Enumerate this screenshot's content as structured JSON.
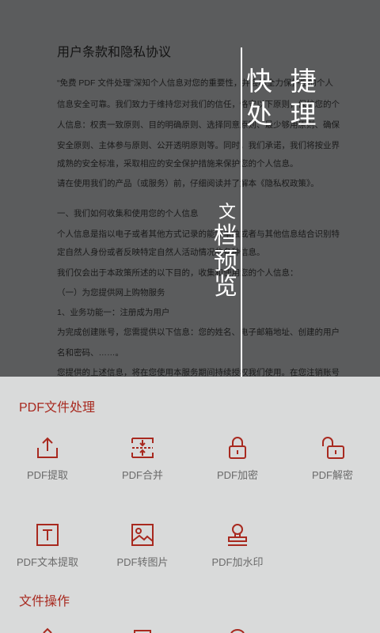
{
  "document": {
    "title": "用户条款和隐私协议",
    "paragraphs": [
      "“免费 PDF 文件处理”深知个人信息对您的重要性，并会尽全力保护您的个人",
      "信息安全可靠。我们致力于维持您对我们的信任，恪守以下原则，保护您的个",
      "人信息：权责一致原则、目的明确原则、选择同意原则、最少够用原则、确保",
      "安全原则、主体参与原则、公开透明原则等。同时，我们承诺，我们将按业界",
      "成熟的安全标准，采取相应的安全保护措施来保护您的个人信息。",
      "请在使用我们的产品（或服务）前，仔细阅读并了解本《隐私权政策》。",
      "一、我们如何收集和使用您的个人信息",
      "个人信息是指以电子或者其他方式记录的能够单独或者与其他信息结合识别特",
      "定自然人身份或者反映特定自然人活动情况的各种信息。",
      "我们仅会出于本政策所述的以下目的，收集和使用您的个人信息：",
      "（一）为您提供网上购物服务",
      "1、业务功能一：注册成为用户",
      "为完成创建账号，您需提供以下信息：您的姓名、电子邮箱地址、创建的用户",
      "名和密码、……。",
      "您提供的上述信息，将在您使用本服务期间持续授权我们使用。在您注销账号"
    ]
  },
  "overlay": {
    "line1": "快 捷",
    "line2": "处 理",
    "vertical_chars": [
      "文",
      "档",
      "预",
      "览"
    ]
  },
  "sections": [
    {
      "title": "PDF文件处理",
      "tools": [
        {
          "label": "PDF提取",
          "icon": "upload-tray-icon"
        },
        {
          "label": "PDF合并",
          "icon": "merge-icon"
        },
        {
          "label": "PDF加密",
          "icon": "lock-icon"
        },
        {
          "label": "PDF解密",
          "icon": "unlock-icon"
        },
        {
          "label": "PDF文本提取",
          "icon": "text-box-icon"
        },
        {
          "label": "PDF转图片",
          "icon": "image-icon"
        },
        {
          "label": "PDF加水印",
          "icon": "stamp-icon"
        }
      ]
    },
    {
      "title": "文件操作"
    }
  ],
  "colors": {
    "accent": "#a8291f",
    "label": "#6b6b6b",
    "panel_bg": "#d9dada",
    "doc_bg": "#5b5c5d"
  }
}
